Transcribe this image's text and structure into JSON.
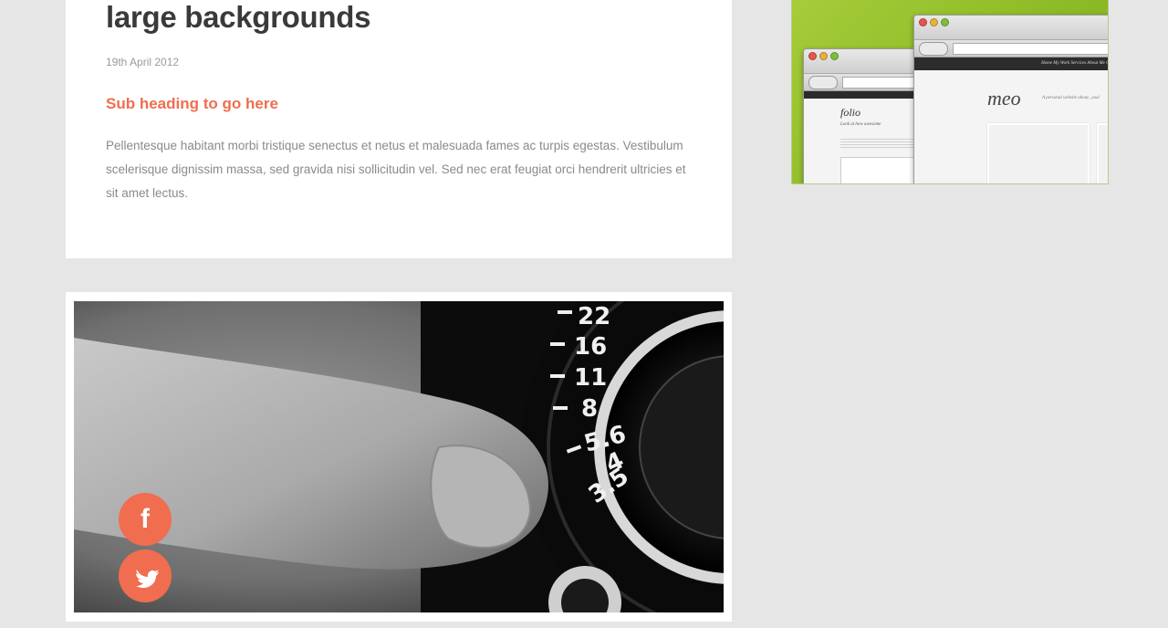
{
  "post": {
    "title": "large backgrounds",
    "date": "19th April 2012",
    "subheading": "Sub heading to go here",
    "body": "Pellentesque habitant morbi tristique senectus et netus et malesuada fames ac turpis egestas. Vestibulum scelerisque dignissim massa, sed gravida nisi sollicitudin vel. Sed nec erat feugiat orci hendrerit ultricies et sit amet lectus."
  },
  "sidebar": {
    "thumbnail": {
      "front_nav": "Home    My Work    Services    About Me    Contact",
      "front_logo": "meo",
      "front_tagline": "A personal website about...you!",
      "back_logo": "folio",
      "back_tagline": "Look at how awesome"
    }
  },
  "image_card": {
    "dial_numbers": [
      "22",
      "16",
      "11",
      "8",
      "5.6",
      "4",
      "3.5"
    ],
    "social": [
      {
        "name": "facebook",
        "icon": "facebook-icon",
        "glyph": "f"
      },
      {
        "name": "twitter",
        "icon": "twitter-icon"
      }
    ]
  },
  "colors": {
    "accent": "#f06d4f",
    "background": "#e6e6e6",
    "title": "#3a3a3a",
    "body_text": "#8a8a8a",
    "thumb_green": "#9cc430"
  }
}
